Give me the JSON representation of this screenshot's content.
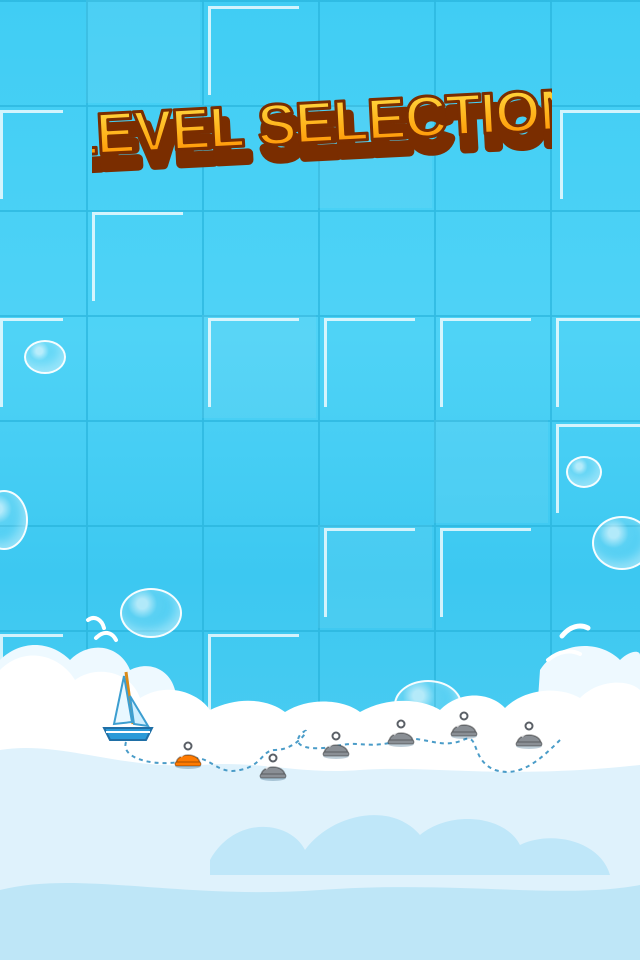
{
  "screen": {
    "title": "LEVEL SELECTION"
  },
  "levels": [
    {
      "id": 1,
      "state": "current",
      "color": "#ff7a00"
    },
    {
      "id": 2,
      "state": "locked",
      "color": "#8a8f95"
    },
    {
      "id": 3,
      "state": "locked",
      "color": "#8a8f95"
    },
    {
      "id": 4,
      "state": "locked",
      "color": "#8a8f95"
    },
    {
      "id": 5,
      "state": "locked",
      "color": "#8a8f95"
    },
    {
      "id": 6,
      "state": "locked",
      "color": "#8a8f95"
    }
  ],
  "icons": {
    "player": "sailboat-icon",
    "level_marker": "buoy-icon"
  },
  "colors": {
    "water": "#40cdf4",
    "title_fill": "#ffb21a",
    "title_outline": "#7a2d00",
    "cloud": "#ffffff"
  }
}
